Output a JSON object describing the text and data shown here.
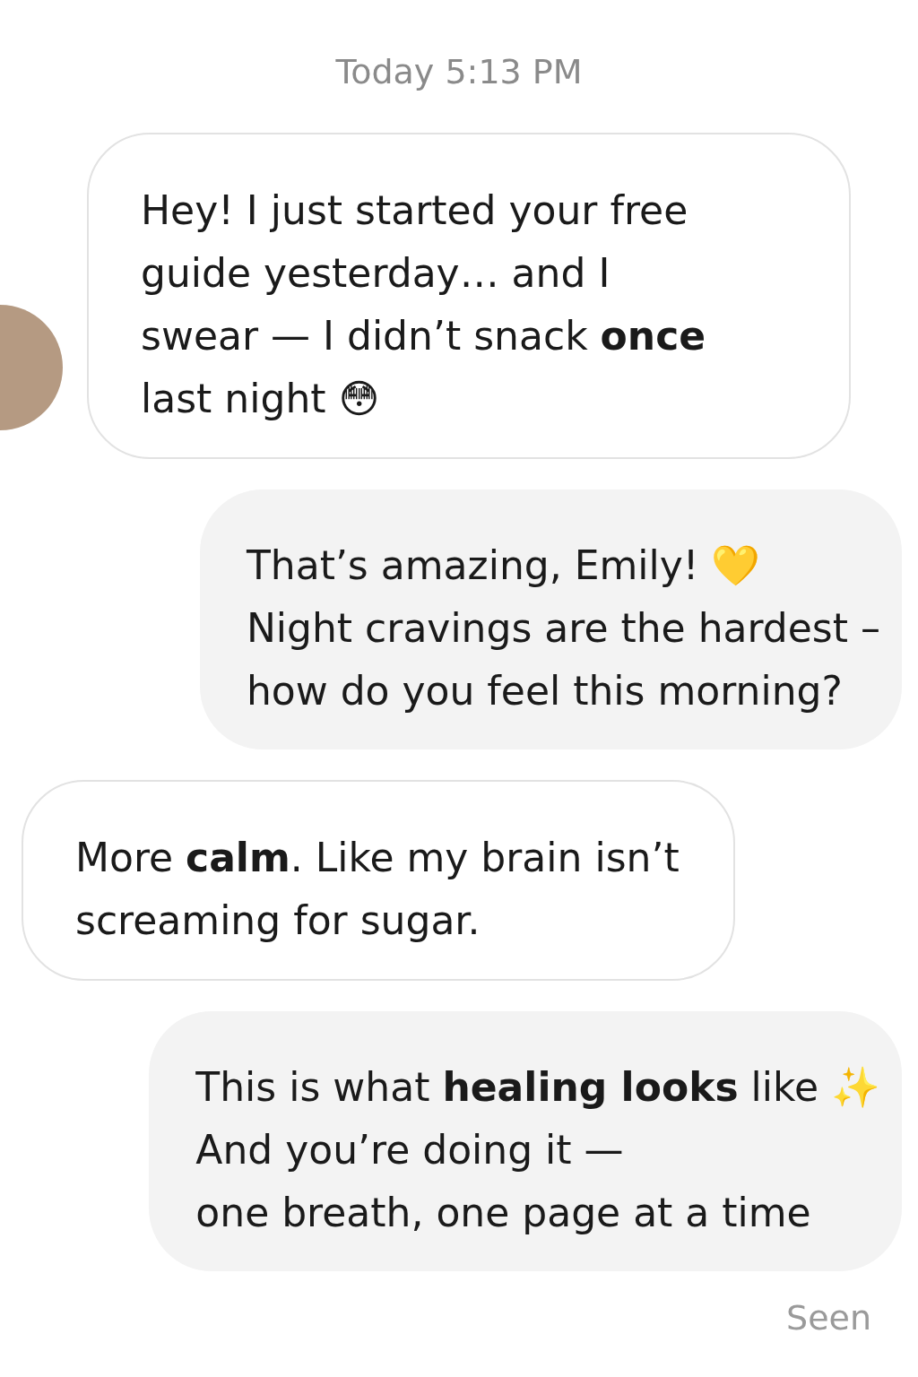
{
  "timestamp": "Today 5:13 PM",
  "messages": [
    {
      "kind": "received",
      "avatar": true,
      "text": "Hey!  I just started your free\nguide yesterday… and I\nswear — I didn’t snack **once**\nlast night 😳"
    },
    {
      "kind": "sent",
      "avatar": false,
      "text": "That’s amazing, Emily! 💛\nNight cravings are the hardest –\nhow do you feel this morning?"
    },
    {
      "kind": "received",
      "avatar": false,
      "text": "More **calm**. Like my brain isn’t\nscreaming for sugar."
    },
    {
      "kind": "sent",
      "avatar": false,
      "text": "This is what **healing looks** like ✨\nAnd you’re doing it —\none breath, one page at a time"
    }
  ],
  "status": "Seen"
}
